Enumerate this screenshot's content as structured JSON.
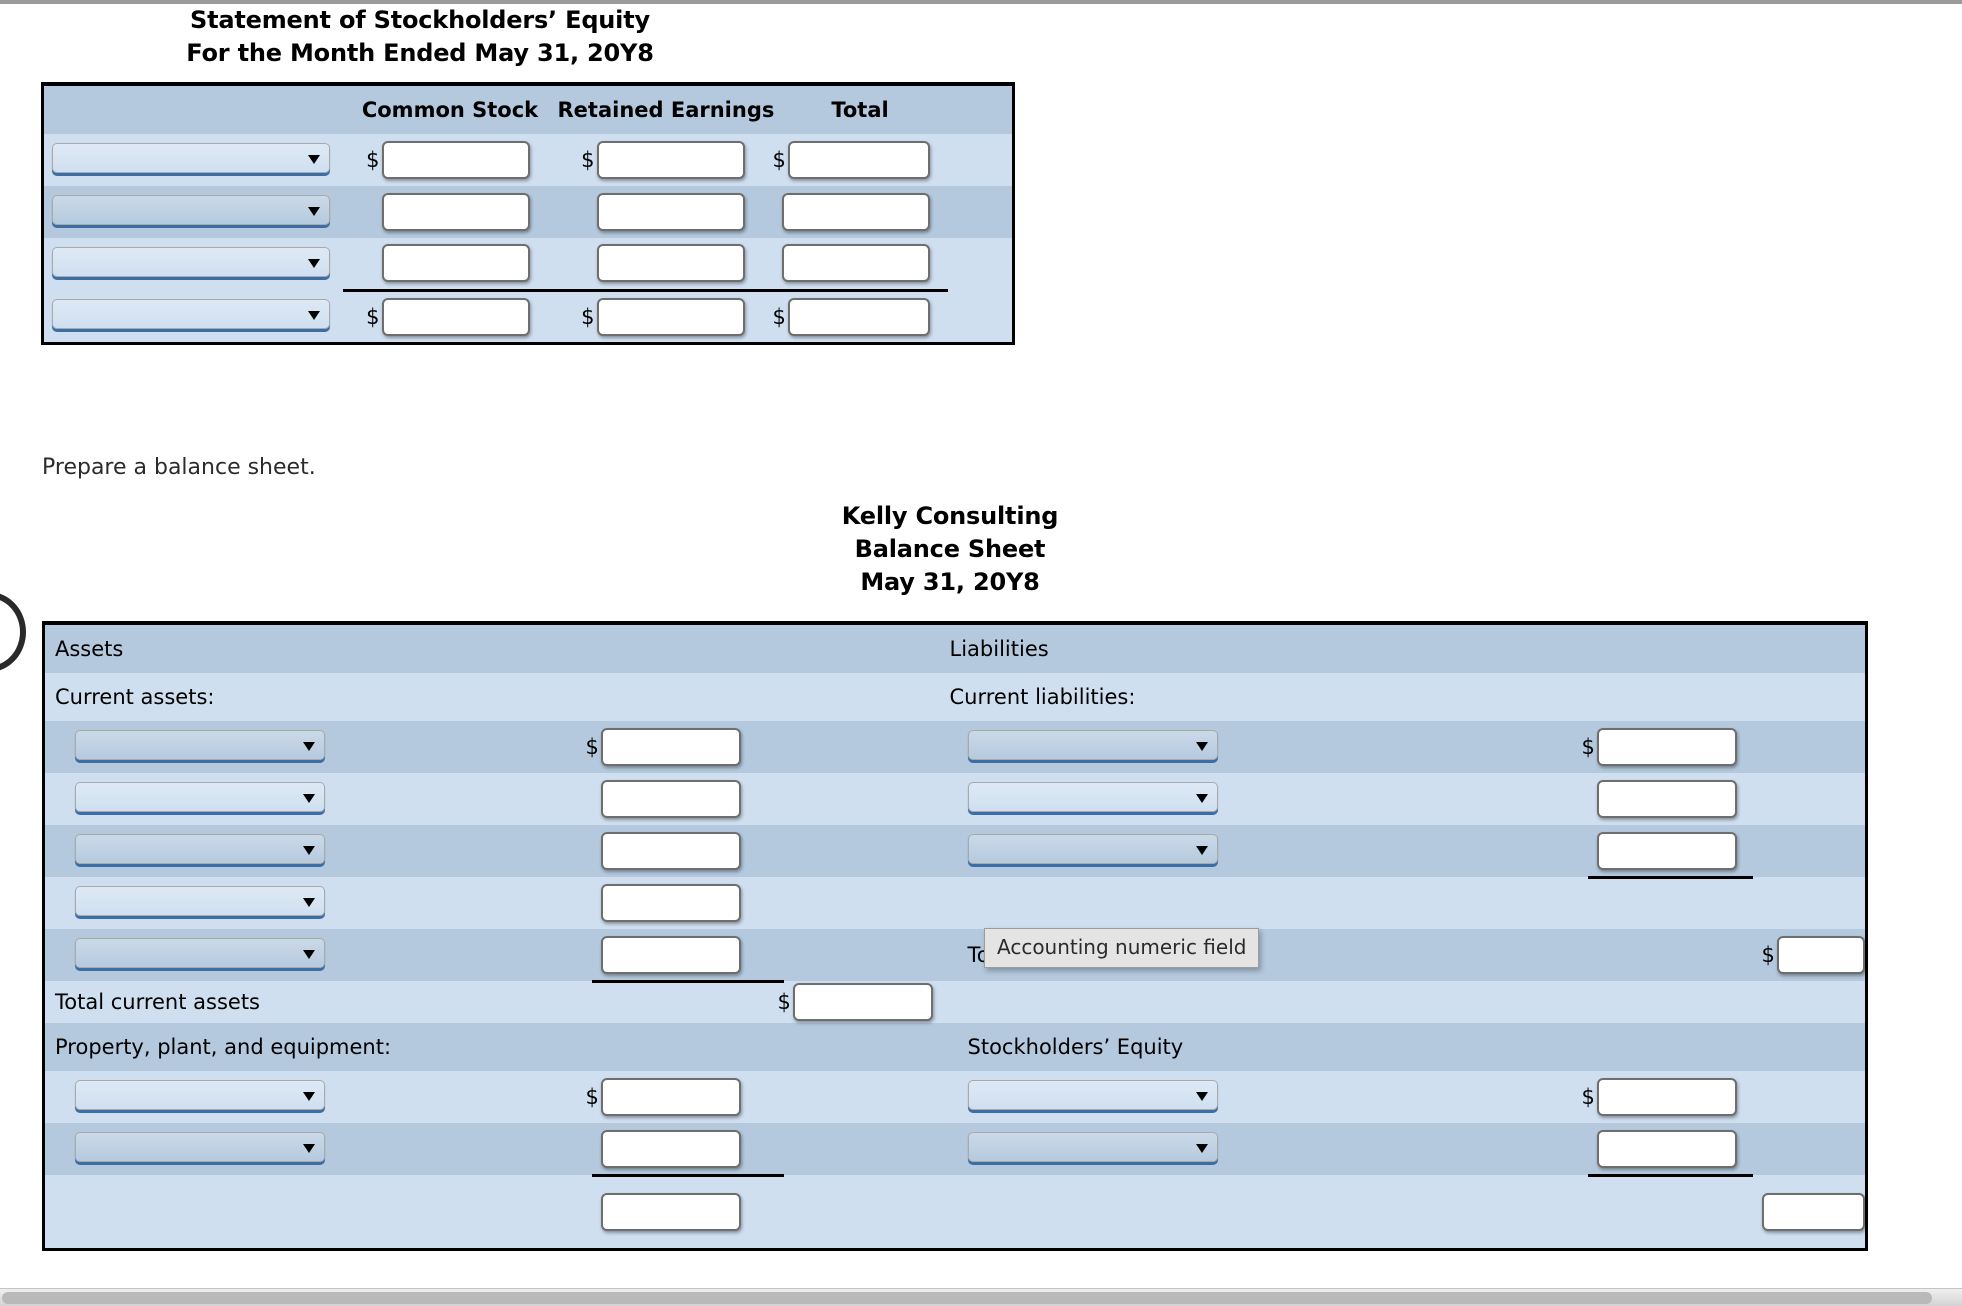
{
  "equity_statement": {
    "title_line1": "Statement of Stockholders’ Equity",
    "title_line2": "For the Month Ended May 31, 20Y8",
    "columns": [
      "Common Stock",
      "Retained Earnings",
      "Total"
    ],
    "dollar_sign": "$",
    "rows": [
      {
        "account": "",
        "common_stock": "",
        "retained_earnings": "",
        "total": "",
        "show_dollar": true
      },
      {
        "account": "",
        "common_stock": "",
        "retained_earnings": "",
        "total": "",
        "show_dollar": false
      },
      {
        "account": "",
        "common_stock": "",
        "retained_earnings": "",
        "total": "",
        "show_dollar": false
      },
      {
        "account": "",
        "common_stock": "",
        "retained_earnings": "",
        "total": "",
        "show_dollar": true
      }
    ]
  },
  "instruction": "Prepare a balance sheet.",
  "balance_sheet": {
    "company": "Kelly Consulting",
    "report": "Balance Sheet",
    "date": "May 31, 20Y8",
    "dollar_sign": "$",
    "left": {
      "section_header": "Assets",
      "subsection_1": "Current assets:",
      "total_current_assets_label": "Total current assets",
      "subsection_2": "Property, plant, and equipment:",
      "current_asset_rows": [
        {
          "account": "",
          "amount": "",
          "show_dollar": true
        },
        {
          "account": "",
          "amount": "",
          "show_dollar": false
        },
        {
          "account": "",
          "amount": "",
          "show_dollar": false
        },
        {
          "account": "",
          "amount": "",
          "show_dollar": false
        },
        {
          "account": "",
          "amount": "",
          "show_dollar": false
        }
      ],
      "total_current_assets_value": "",
      "ppe_rows": [
        {
          "account": "",
          "amount": "",
          "show_dollar": true
        },
        {
          "account": "",
          "amount": "",
          "show_dollar": false
        }
      ],
      "ppe_total_value": ""
    },
    "right": {
      "section_header": "Liabilities",
      "subsection_1": "Current liabilities:",
      "total_liabilities_label": "Total liabilities",
      "subsection_2": "Stockholders’ Equity",
      "current_liability_rows": [
        {
          "account": "",
          "amount": "",
          "show_dollar": true
        },
        {
          "account": "",
          "amount": "",
          "show_dollar": false
        },
        {
          "account": "",
          "amount": "",
          "show_dollar": false
        }
      ],
      "total_liabilities_value": "",
      "equity_rows": [
        {
          "account": "",
          "amount": "",
          "show_dollar": true
        },
        {
          "account": "",
          "amount": "",
          "show_dollar": false
        }
      ],
      "equity_total_value": ""
    }
  },
  "tooltip": {
    "text": "Accounting numeric field"
  },
  "colors": {
    "row_dark": "#b4c9de",
    "row_light": "#cfdff0",
    "select_underline": "#3c6ea5",
    "border": "#000000",
    "tooltip_bg": "#e4e4e4"
  }
}
